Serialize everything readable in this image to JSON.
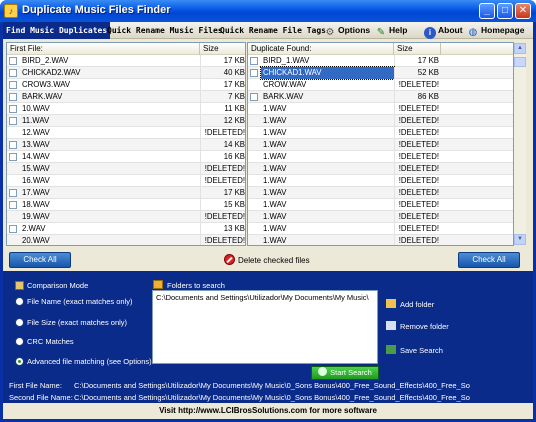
{
  "window": {
    "title": "Duplicate Music Files Finder",
    "minimize": "_",
    "maximize": "□",
    "close": "✕"
  },
  "toolbar": {
    "tabs": [
      "Find Music Duplicates",
      "Quick Rename Music Files",
      "Quick Rename File Tags"
    ],
    "options": "Options",
    "help": "Help",
    "about": "About",
    "homepage": "Homepage"
  },
  "left_grid": {
    "headers": [
      "First File:",
      "Size"
    ],
    "rows": [
      {
        "name": "BIRD_2.WAV",
        "size": "17 KB",
        "checkbox": true
      },
      {
        "name": "CHICKAD2.WAV",
        "size": "40 KB",
        "checkbox": true
      },
      {
        "name": "CROW3.WAV",
        "size": "17 KB",
        "checkbox": true
      },
      {
        "name": "BARK.WAV",
        "size": "7 KB",
        "checkbox": true
      },
      {
        "name": "10.WAV",
        "size": "11 KB",
        "checkbox": true
      },
      {
        "name": "11.WAV",
        "size": "12 KB",
        "checkbox": true
      },
      {
        "name": "12.WAV",
        "size": "!DELETED!",
        "checkbox": false
      },
      {
        "name": "13.WAV",
        "size": "14 KB",
        "checkbox": true
      },
      {
        "name": "14.WAV",
        "size": "16 KB",
        "checkbox": true
      },
      {
        "name": "15.WAV",
        "size": "!DELETED!",
        "checkbox": false
      },
      {
        "name": "16.WAV",
        "size": "!DELETED!",
        "checkbox": false
      },
      {
        "name": "17.WAV",
        "size": "17 KB",
        "checkbox": true
      },
      {
        "name": "18.WAV",
        "size": "15 KB",
        "checkbox": true
      },
      {
        "name": "19.WAV",
        "size": "!DELETED!",
        "checkbox": false
      },
      {
        "name": "2.WAV",
        "size": "13 KB",
        "checkbox": true
      },
      {
        "name": "20.WAV",
        "size": "!DELETED!",
        "checkbox": false
      }
    ]
  },
  "right_grid": {
    "headers": [
      "Duplicate Found:",
      "Size"
    ],
    "rows": [
      {
        "name": "BIRD_1.WAV",
        "size": "17 KB",
        "checkbox": true
      },
      {
        "name": "CHICKAD1.WAV",
        "size": "52 KB",
        "checkbox": true,
        "selected": true
      },
      {
        "name": "CROW.WAV",
        "size": "!DELETED!",
        "checkbox": false
      },
      {
        "name": "BARK.WAV",
        "size": "86 KB",
        "checkbox": true
      },
      {
        "name": "1.WAV",
        "size": "!DELETED!",
        "checkbox": false
      },
      {
        "name": "1.WAV",
        "size": "!DELETED!",
        "checkbox": false
      },
      {
        "name": "1.WAV",
        "size": "!DELETED!",
        "checkbox": false
      },
      {
        "name": "1.WAV",
        "size": "!DELETED!",
        "checkbox": false
      },
      {
        "name": "1.WAV",
        "size": "!DELETED!",
        "checkbox": false
      },
      {
        "name": "1.WAV",
        "size": "!DELETED!",
        "checkbox": false
      },
      {
        "name": "1.WAV",
        "size": "!DELETED!",
        "checkbox": false
      },
      {
        "name": "1.WAV",
        "size": "!DELETED!",
        "checkbox": false
      },
      {
        "name": "1.WAV",
        "size": "!DELETED!",
        "checkbox": false
      },
      {
        "name": "1.WAV",
        "size": "!DELETED!",
        "checkbox": false
      },
      {
        "name": "1.WAV",
        "size": "!DELETED!",
        "checkbox": false
      },
      {
        "name": "1.WAV",
        "size": "!DELETED!",
        "checkbox": false
      }
    ]
  },
  "actions": {
    "check_all_left": "Check All",
    "check_all_right": "Check All",
    "delete_checked": "Delete checked files"
  },
  "comparison": {
    "title": "Comparison Mode",
    "modes": [
      {
        "label": "File Name (exact matches only)",
        "selected": false
      },
      {
        "label": "File Size (exact matches only)",
        "selected": false
      },
      {
        "label": "CRC Matches",
        "selected": false
      },
      {
        "label": "Advanced file matching (see Options)",
        "selected": true
      }
    ]
  },
  "folders": {
    "title": "Folders to search",
    "items": [
      "C:\\Documents and Settings\\Utilizador\\My Documents\\My Music\\"
    ],
    "add": "Add folder",
    "remove": "Remove folder",
    "save": "Save Search",
    "start": "Start Search"
  },
  "file_names": {
    "first_label": "First File Name:",
    "first_value": "C:\\Documents and Settings\\Utilizador\\My Documents\\My Music\\0_Sons Bonus\\400_Free_Sound_Effects\\400_Free_So",
    "second_label": "Second File Name:",
    "second_value": "C:\\Documents and Settings\\Utilizador\\My Documents\\My Music\\0_Sons Bonus\\400_Free_Sound_Effects\\400_Free_So"
  },
  "footer": {
    "text": "Visit http://www.LCIBrosSolutions.com for more software"
  },
  "colors": {
    "titlebar": "#0a5ce6",
    "panel": "#0b2b8a",
    "face": "#ece9d8",
    "selection": "#316ac5",
    "start": "#1f9a1f"
  }
}
